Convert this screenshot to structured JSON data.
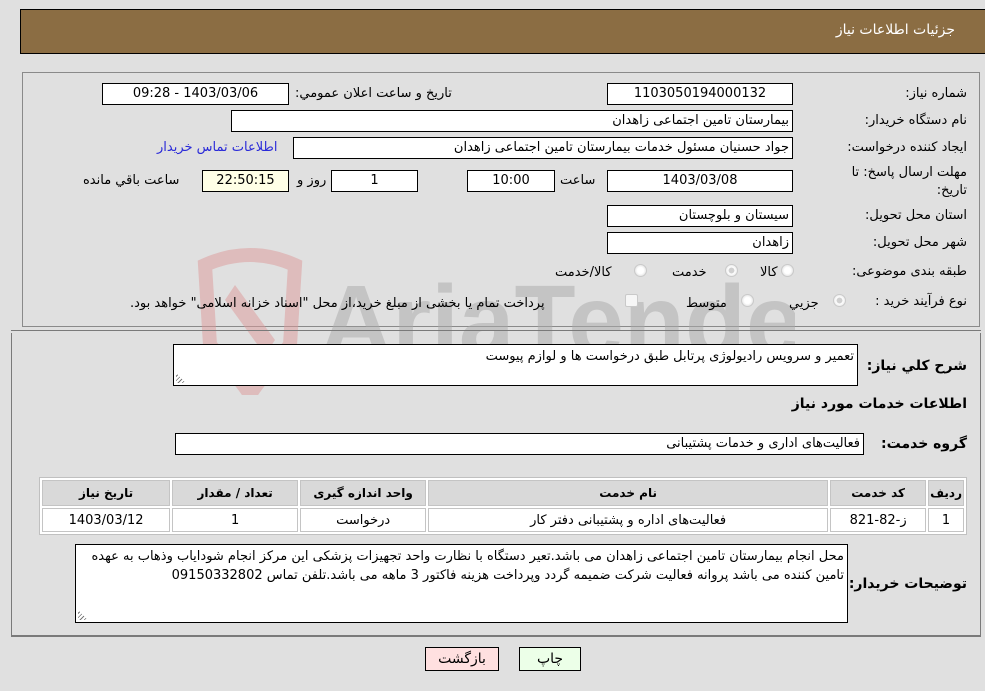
{
  "header": {
    "title": "جزئیات اطلاعات نیاز"
  },
  "fields": {
    "need_number": {
      "label": "شماره نیاز:",
      "value": "1103050194000132"
    },
    "announce_datetime": {
      "label": "تاریخ و ساعت اعلان عمومي:",
      "value": "1403/03/06 - 09:28"
    },
    "buyer_org": {
      "label": "نام دستگاه خریدار:",
      "value": "بیمارستان تامین اجتماعی زاهدان"
    },
    "requester": {
      "label": "ایجاد کننده درخواست:",
      "value": "جواد حسنیان مسئول خدمات بیمارستان تامین اجتماعی زاهدان"
    },
    "buyer_contact_link": "اطلاعات تماس خریدار",
    "deadline": {
      "label": "مهلت ارسال پاسخ: تا تاریخ:",
      "date": "1403/03/08",
      "time_label": "ساعت",
      "time": "10:00",
      "days": "1",
      "days_label": "روز و",
      "remaining": "22:50:15",
      "remaining_label": "ساعت باقي مانده"
    },
    "province": {
      "label": "استان محل تحویل:",
      "value": "سیستان و بلوچستان"
    },
    "city": {
      "label": "شهر محل تحویل:",
      "value": "زاهدان"
    },
    "category": {
      "label": "طبقه بندی موضوعی:",
      "options": [
        "کالا",
        "خدمت",
        "کالا/خدمت"
      ],
      "selected": "خدمت"
    },
    "purchase_type": {
      "label": "نوع فرآیند خرید :",
      "options": [
        "جزيي",
        "متوسط"
      ],
      "selected": "جزيي",
      "treasury_note": "پرداخت تمام یا بخشی از مبلغ خرید،از محل \"اسناد خزانه اسلامی\" خواهد بود."
    }
  },
  "summary": {
    "label": "شرح کلي نياز:",
    "value": "تعمیر و سرویس رادیولوژی پرتابل طبق درخواست ها و لوازم پیوست"
  },
  "services_section": {
    "title": "اطلاعات خدمات مورد نیاز"
  },
  "service_group": {
    "label": "گروه خدمت:",
    "value": "فعالیت‌های اداری و خدمات پشتیبانی"
  },
  "table": {
    "headers": [
      "ردیف",
      "کد خدمت",
      "نام خدمت",
      "واحد اندازه گیری",
      "تعداد / مقدار",
      "تاریخ نیاز"
    ],
    "rows": [
      [
        "1",
        "ز-82-821",
        "فعالیت‌های اداره و پشتیبانی دفتر کار",
        "درخواست",
        "1",
        "1403/03/12"
      ]
    ]
  },
  "buyer_notes": {
    "label": "توضیحات خریدار:",
    "value": "محل انجام بیمارستان تامین اجتماعی زاهدان می باشد.تعیر دستگاه با نظارت واحد تجهیزات پزشکی این مرکز انجام شودایاب وذهاب به عهده تامین کننده می باشد پروانه فعالیت شرکت ضمیمه گردد وپرداخت هزینه فاکتور 3 ماهه می باشد.تلفن تماس 09150332802"
  },
  "buttons": {
    "print": "چاپ",
    "back": "بازگشت"
  },
  "watermark": {
    "text": "AriaTender.neT"
  }
}
